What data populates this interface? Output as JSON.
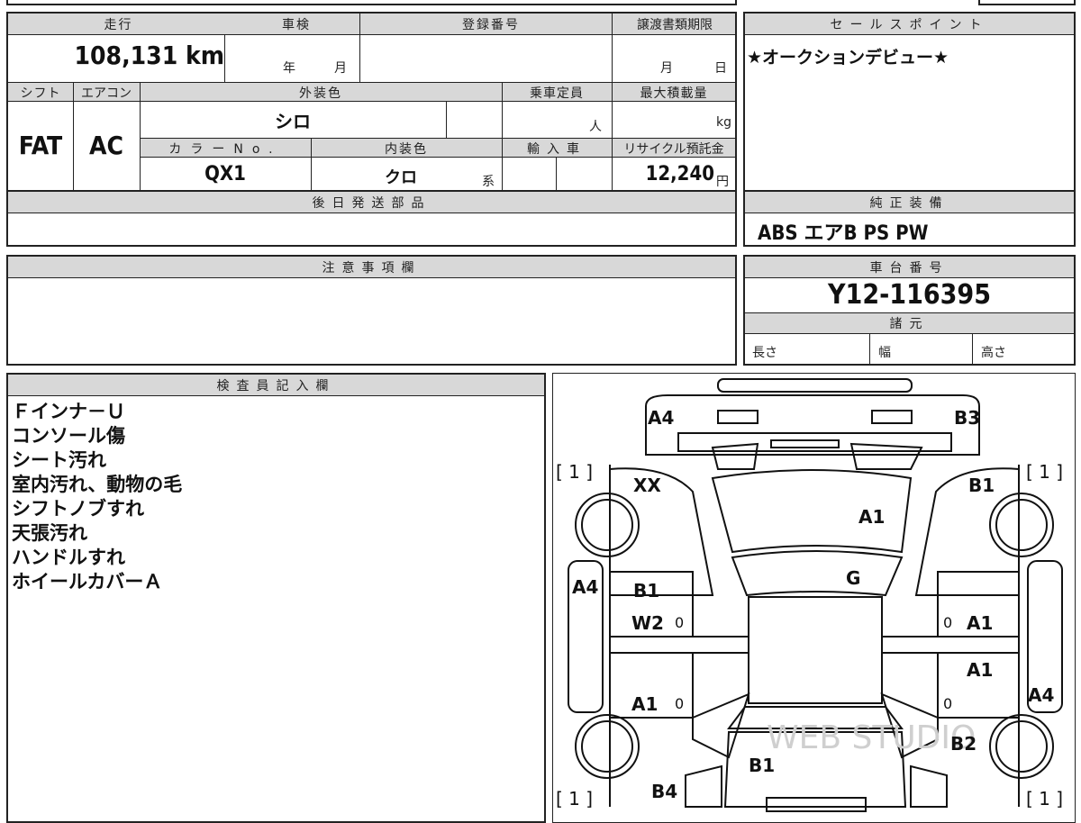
{
  "headers": {
    "mileage": "走行",
    "inspection": "車検",
    "registration": "登録番号",
    "transfer_deadline": "譲渡書類期限",
    "sales_point": "セールスポイント",
    "shift": "シフト",
    "aircon": "エアコン",
    "exterior_color": "外装色",
    "capacity": "乗車定員",
    "max_load": "最大積載量",
    "color_no": "カラーNo.",
    "interior_color": "内装色",
    "import_car": "輸入車",
    "recycle_fee": "リサイクル預託金",
    "later_parts": "後日発送部品",
    "standard_equipment": "純正装備",
    "notes": "注意事項欄",
    "chassis_no": "車台番号",
    "specs": "諸元",
    "inspector_notes": "検査員記入欄"
  },
  "vehicle": {
    "mileage": "108,131 km",
    "inspection_year_unit": "年",
    "inspection_month_unit": "月",
    "registration_no": "",
    "deadline_month_unit": "月",
    "deadline_day_unit": "日",
    "shift": "FAT",
    "aircon": "AC",
    "exterior_color": "シロ",
    "capacity_unit": "人",
    "load_unit": "kg",
    "color_no": "QX1",
    "interior_color": "クロ",
    "interior_suffix": "系",
    "recycle_fee": "12,240",
    "recycle_unit": "円",
    "chassis_no": "Y12-116395",
    "standard_equipment": "ABS エアB PS PW",
    "sales_point": "★オークションデビュー★"
  },
  "specs": {
    "length_label": "長さ",
    "width_label": "幅",
    "height_label": "高さ"
  },
  "inspector_notes": [
    "Ｆインナ－Ｕ",
    "コンソール傷",
    "シート汚れ",
    "室内汚れ、動物の毛",
    "シフトノブすれ",
    "天張汚れ",
    "ハンドルすれ",
    "ホイールカバーＡ"
  ],
  "diagram": {
    "marks": {
      "front_left_corner": "A4",
      "front_right_corner": "B3",
      "fender_left": "XX",
      "fender_right": "B1",
      "hood": "A1",
      "windshield": "G",
      "left_side": "A4",
      "front_door_left_1": "B1",
      "front_door_left_2": "W2",
      "rear_door_left": "A1",
      "front_door_right": "A1",
      "rear_door_right": "A1",
      "right_side": "A4",
      "rear_quarter_right": "B2",
      "rear_gate": "B1",
      "rear_quarter_left": "B4"
    },
    "tire_front_left": "[ 1 ]",
    "tire_front_right": "[ 1 ]",
    "tire_rear_left": "[ 1 ]",
    "tire_rear_right": "[ 1 ]",
    "zero_mark": "0",
    "watermark": "WEB STUDIO"
  }
}
